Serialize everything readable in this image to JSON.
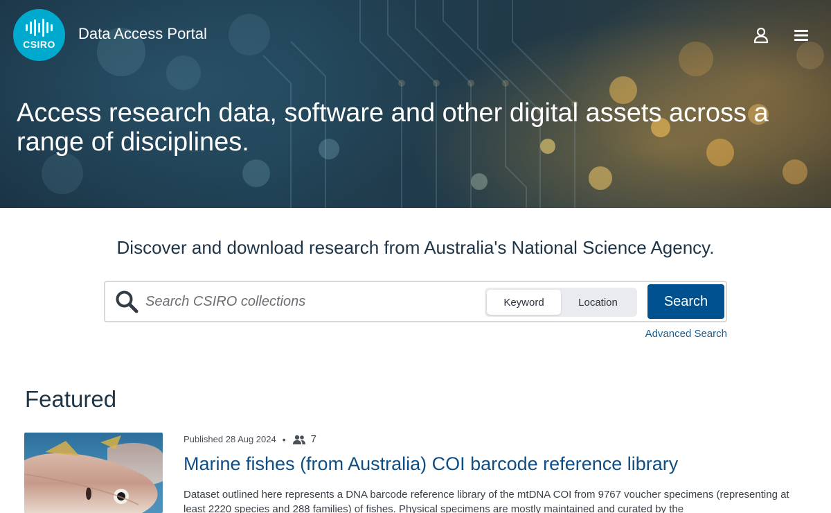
{
  "header": {
    "logo_text": "CSIRO",
    "portal_title": "Data Access Portal",
    "user_icon": "user-icon",
    "menu_icon": "hamburger-menu-icon"
  },
  "hero": {
    "headline": "Access research data, software and other digital assets across a range of disciplines."
  },
  "discover": {
    "tagline": "Discover and download research from Australia's National Science Agency."
  },
  "search": {
    "placeholder": "Search CSIRO collections",
    "value": "",
    "modes": [
      {
        "label": "Keyword",
        "active": true
      },
      {
        "label": "Location",
        "active": false
      }
    ],
    "button_label": "Search",
    "advanced_link": "Advanced Search"
  },
  "featured": {
    "heading": "Featured",
    "items": [
      {
        "published": "Published 28 Aug 2024",
        "contributors": "7",
        "title": "Marine fishes (from Australia) COI barcode reference library",
        "description": "Dataset outlined here represents a DNA barcode reference library of the mtDNA COI from 9767 voucher specimens (representing at least 2220 species and 288 families) of fishes. Physical specimens are mostly maintained and curated by the"
      }
    ]
  },
  "colors": {
    "logo_bg": "#00a9ce",
    "search_button": "#00518f",
    "link": "#1f5c8a",
    "title": "#0f4e84"
  }
}
